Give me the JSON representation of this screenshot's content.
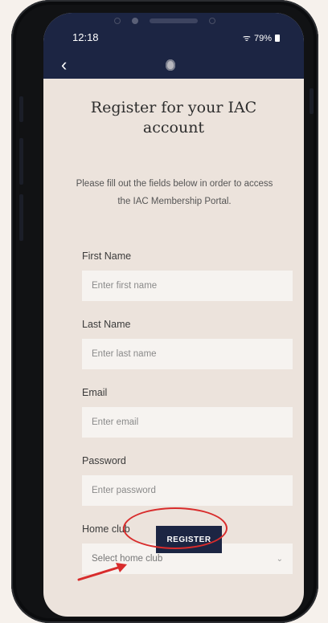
{
  "status_bar": {
    "time": "12:18",
    "signal_label": "ᯤ",
    "battery": "79%"
  },
  "nav": {
    "back_icon": "‹"
  },
  "header": {
    "title": "Register for your IAC account"
  },
  "intro": {
    "text": "Please fill out the fields below in order to access the IAC Membership Portal."
  },
  "form": {
    "first_name": {
      "label": "First Name",
      "placeholder": "Enter first name"
    },
    "last_name": {
      "label": "Last Name",
      "placeholder": "Enter last name"
    },
    "email": {
      "label": "Email",
      "placeholder": "Enter email"
    },
    "password": {
      "label": "Password",
      "placeholder": "Enter password"
    },
    "home_club": {
      "label": "Home club",
      "selected": "Select home club",
      "chevron": "⌄"
    }
  },
  "register_button": {
    "label": "REGISTER"
  },
  "colors": {
    "navy": "#1c2543",
    "annotation_red": "#d82c2c",
    "screen_bg": "#ece3dc"
  }
}
